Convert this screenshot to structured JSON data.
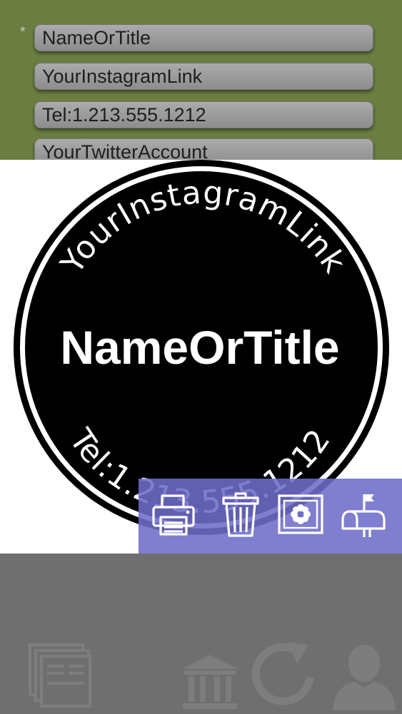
{
  "form": {
    "required_marker": "*",
    "fields": [
      {
        "name": "name-or-title-field",
        "value": "NameOrTitle"
      },
      {
        "name": "instagram-link-field",
        "value": "YourInstagramLink"
      },
      {
        "name": "telephone-field",
        "value": "Tel:1.213.555.1212"
      },
      {
        "name": "twitter-account-field",
        "value": "YourTwitterAccount"
      }
    ]
  },
  "stamp": {
    "top_arc_text": "YourInstagramLink",
    "center_text": "NameOrTitle",
    "bottom_arc_text": "Tel:1.213.555.1212",
    "fill_color": "#000000",
    "text_color": "#ffffff"
  },
  "action_bar": {
    "color": "#6e6cc8",
    "buttons": [
      "printer-icon",
      "trash-icon",
      "flower-frame-icon",
      "mailbox-icon"
    ]
  },
  "bottom_tabs": [
    "documents-icon",
    "bank-icon",
    "refresh-icon",
    "user-icon"
  ]
}
